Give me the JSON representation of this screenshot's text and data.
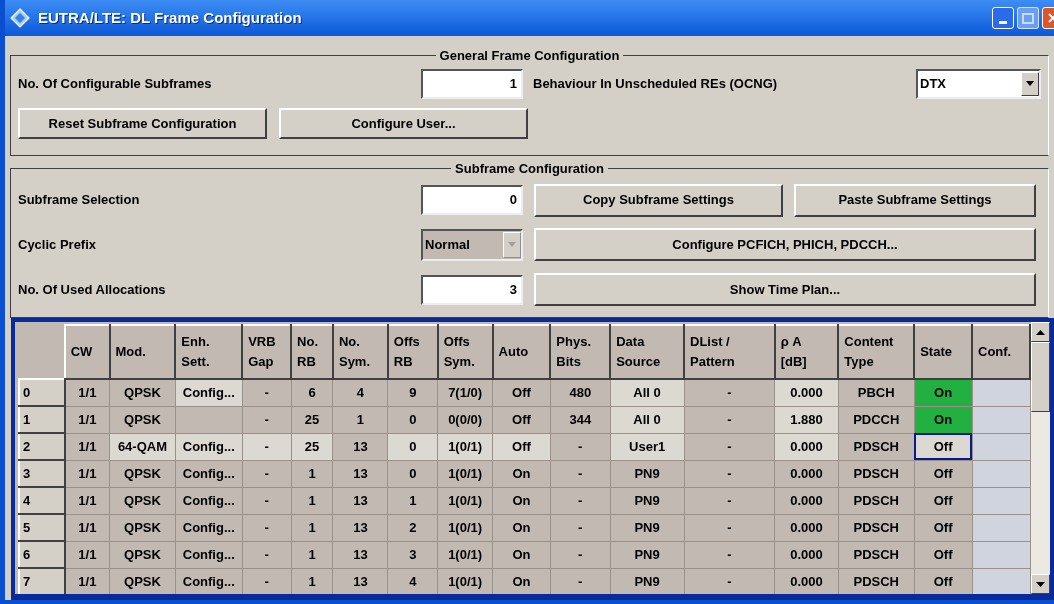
{
  "window": {
    "title": "EUTRA/LTE: DL Frame Configuration"
  },
  "general": {
    "title": "General Frame Configuration",
    "subframes_label": "No. Of Configurable Subframes",
    "subframes_value": "1",
    "ocng_label": "Behaviour In Unscheduled REs (OCNG)",
    "ocng_value": "DTX",
    "buttons": [
      "Reset Subframe Configuration",
      "Configure User..."
    ]
  },
  "subframe": {
    "title": "Subframe Configuration",
    "selection_label": "Subframe Selection",
    "selection_value": "0",
    "copy_button": "Copy Subframe Settings",
    "paste_button": "Paste Subframe Settings",
    "prefix_label": "Cyclic Prefix",
    "prefix_value": "Normal",
    "prefix_disabled": true,
    "pcfich_button": "Configure PCFICH, PHICH, PDCCH...",
    "allocations_label": "No. Of Used Allocations",
    "allocations_value": "3",
    "timeplan_button": "Show Time Plan..."
  },
  "table": {
    "columns": [
      {
        "label": "CW",
        "kind": "text"
      },
      {
        "label": "Mod.",
        "kind": "text"
      },
      {
        "label": "Enh.\nSett.",
        "kind": "text"
      },
      {
        "label": "VRB\nGap",
        "kind": "text"
      },
      {
        "label": "No.\nRB",
        "kind": "text"
      },
      {
        "label": "No.\nSym.",
        "kind": "text"
      },
      {
        "label": "Offs\nRB",
        "kind": "text"
      },
      {
        "label": "Offs\nSym.",
        "kind": "text"
      },
      {
        "label": "Auto",
        "kind": "text"
      },
      {
        "label": "Phys.\nBits",
        "kind": "text"
      },
      {
        "label": "Data\nSource",
        "kind": "text"
      },
      {
        "label": "DList /\nPattern",
        "kind": "text"
      },
      {
        "label": "ρ A\n[dB]",
        "kind": "text"
      },
      {
        "label": "Content\nType",
        "kind": "text"
      },
      {
        "label": "State",
        "kind": "state"
      },
      {
        "label": "Conf.",
        "kind": "conf"
      }
    ],
    "rows": [
      {
        "header": "0",
        "state": "On",
        "state_on": true,
        "state_focused": false,
        "cells": [
          {
            "text": "1/1",
            "highlighted": false
          },
          {
            "text": "QPSK",
            "highlighted": false
          },
          {
            "text": "Config...",
            "highlighted": true
          },
          {
            "text": "-",
            "highlighted": false
          },
          {
            "text": "6",
            "highlighted": false
          },
          {
            "text": "4",
            "highlighted": false
          },
          {
            "text": "9",
            "highlighted": false
          },
          {
            "text": "7(1/0)",
            "highlighted": false
          },
          {
            "text": "Off",
            "highlighted": false
          },
          {
            "text": "480",
            "highlighted": false
          },
          {
            "text": "All 0",
            "highlighted": true
          },
          {
            "text": "-",
            "highlighted": false
          },
          {
            "text": "0.000",
            "highlighted": true
          },
          {
            "text": "PBCH",
            "highlighted": false
          }
        ]
      },
      {
        "header": "1",
        "state": "On",
        "state_on": true,
        "state_focused": false,
        "cells": [
          {
            "text": "1/1",
            "highlighted": false
          },
          {
            "text": "QPSK",
            "highlighted": false
          },
          {
            "highlighted": false
          },
          {
            "text": "-",
            "highlighted": false
          },
          {
            "text": "25",
            "highlighted": false
          },
          {
            "text": "1",
            "highlighted": false
          },
          {
            "text": "0",
            "highlighted": false
          },
          {
            "text": "0(0/0)",
            "highlighted": false
          },
          {
            "text": "Off",
            "highlighted": false
          },
          {
            "text": "344",
            "highlighted": false
          },
          {
            "text": "All 0",
            "highlighted": true
          },
          {
            "text": "-",
            "highlighted": false
          },
          {
            "text": "1.880",
            "highlighted": true
          },
          {
            "text": "PDCCH",
            "highlighted": false
          }
        ]
      },
      {
        "header": "2",
        "state": "Off",
        "state_on": false,
        "state_focused": true,
        "cells": [
          {
            "text": "1/1",
            "highlighted": false
          },
          {
            "text": "64-QAM",
            "highlighted": true
          },
          {
            "text": "Config...",
            "highlighted": true
          },
          {
            "text": "-",
            "highlighted": true
          },
          {
            "text": "25",
            "highlighted": true
          },
          {
            "text": "13",
            "highlighted": false
          },
          {
            "text": "0",
            "highlighted": true
          },
          {
            "text": "1(0/1)",
            "highlighted": true
          },
          {
            "text": "Off",
            "highlighted": true
          },
          {
            "text": "-",
            "highlighted": false
          },
          {
            "text": "User1",
            "highlighted": true
          },
          {
            "text": "-",
            "highlighted": false
          },
          {
            "text": "0.000",
            "highlighted": true
          },
          {
            "text": "PDSCH",
            "highlighted": false
          }
        ]
      },
      {
        "header": "3",
        "state": "Off",
        "state_on": false,
        "state_focused": false,
        "cells": [
          {
            "text": "1/1",
            "highlighted": false
          },
          {
            "text": "QPSK",
            "highlighted": false
          },
          {
            "text": "Config...",
            "highlighted": false
          },
          {
            "text": "-",
            "highlighted": false
          },
          {
            "text": "1",
            "highlighted": false
          },
          {
            "text": "13",
            "highlighted": false
          },
          {
            "text": "0",
            "highlighted": false
          },
          {
            "text": "1(0/1)",
            "highlighted": false
          },
          {
            "text": "On",
            "highlighted": false
          },
          {
            "text": "-",
            "highlighted": false
          },
          {
            "text": "PN9",
            "highlighted": false
          },
          {
            "text": "-",
            "highlighted": false
          },
          {
            "text": "0.000",
            "highlighted": false
          },
          {
            "text": "PDSCH",
            "highlighted": false
          }
        ]
      },
      {
        "header": "4",
        "state": "Off",
        "state_on": false,
        "state_focused": false,
        "cells": [
          {
            "text": "1/1",
            "highlighted": false
          },
          {
            "text": "QPSK",
            "highlighted": false
          },
          {
            "text": "Config...",
            "highlighted": false
          },
          {
            "text": "-",
            "highlighted": false
          },
          {
            "text": "1",
            "highlighted": false
          },
          {
            "text": "13",
            "highlighted": false
          },
          {
            "text": "1",
            "highlighted": false
          },
          {
            "text": "1(0/1)",
            "highlighted": false
          },
          {
            "text": "On",
            "highlighted": false
          },
          {
            "text": "-",
            "highlighted": false
          },
          {
            "text": "PN9",
            "highlighted": false
          },
          {
            "text": "-",
            "highlighted": false
          },
          {
            "text": "0.000",
            "highlighted": false
          },
          {
            "text": "PDSCH",
            "highlighted": false
          }
        ]
      },
      {
        "header": "5",
        "state": "Off",
        "state_on": false,
        "state_focused": false,
        "cells": [
          {
            "text": "1/1",
            "highlighted": false
          },
          {
            "text": "QPSK",
            "highlighted": false
          },
          {
            "text": "Config...",
            "highlighted": false
          },
          {
            "text": "-",
            "highlighted": false
          },
          {
            "text": "1",
            "highlighted": false
          },
          {
            "text": "13",
            "highlighted": false
          },
          {
            "text": "2",
            "highlighted": false
          },
          {
            "text": "1(0/1)",
            "highlighted": false
          },
          {
            "text": "On",
            "highlighted": false
          },
          {
            "text": "-",
            "highlighted": false
          },
          {
            "text": "PN9",
            "highlighted": false
          },
          {
            "text": "-",
            "highlighted": false
          },
          {
            "text": "0.000",
            "highlighted": false
          },
          {
            "text": "PDSCH",
            "highlighted": false
          }
        ]
      },
      {
        "header": "6",
        "state": "Off",
        "state_on": false,
        "state_focused": false,
        "cells": [
          {
            "text": "1/1",
            "highlighted": false
          },
          {
            "text": "QPSK",
            "highlighted": false
          },
          {
            "text": "Config...",
            "highlighted": false
          },
          {
            "text": "-",
            "highlighted": false
          },
          {
            "text": "1",
            "highlighted": false
          },
          {
            "text": "13",
            "highlighted": false
          },
          {
            "text": "3",
            "highlighted": false
          },
          {
            "text": "1(0/1)",
            "highlighted": false
          },
          {
            "text": "On",
            "highlighted": false
          },
          {
            "text": "-",
            "highlighted": false
          },
          {
            "text": "PN9",
            "highlighted": false
          },
          {
            "text": "-",
            "highlighted": false
          },
          {
            "text": "0.000",
            "highlighted": false
          },
          {
            "text": "PDSCH",
            "highlighted": false
          }
        ]
      },
      {
        "header": "7",
        "state": "Off",
        "state_on": false,
        "state_focused": false,
        "cells": [
          {
            "text": "1/1",
            "highlighted": false
          },
          {
            "text": "QPSK",
            "highlighted": false
          },
          {
            "text": "Config...",
            "highlighted": false
          },
          {
            "text": "-",
            "highlighted": false
          },
          {
            "text": "1",
            "highlighted": false
          },
          {
            "text": "13",
            "highlighted": false
          },
          {
            "text": "4",
            "highlighted": false
          },
          {
            "text": "1(0/1)",
            "highlighted": false
          },
          {
            "text": "On",
            "highlighted": false
          },
          {
            "text": "-",
            "highlighted": false
          },
          {
            "text": "PN9",
            "highlighted": false
          },
          {
            "text": "-",
            "highlighted": false
          },
          {
            "text": "0.000",
            "highlighted": false
          },
          {
            "text": "PDSCH",
            "highlighted": false
          }
        ]
      }
    ]
  }
}
